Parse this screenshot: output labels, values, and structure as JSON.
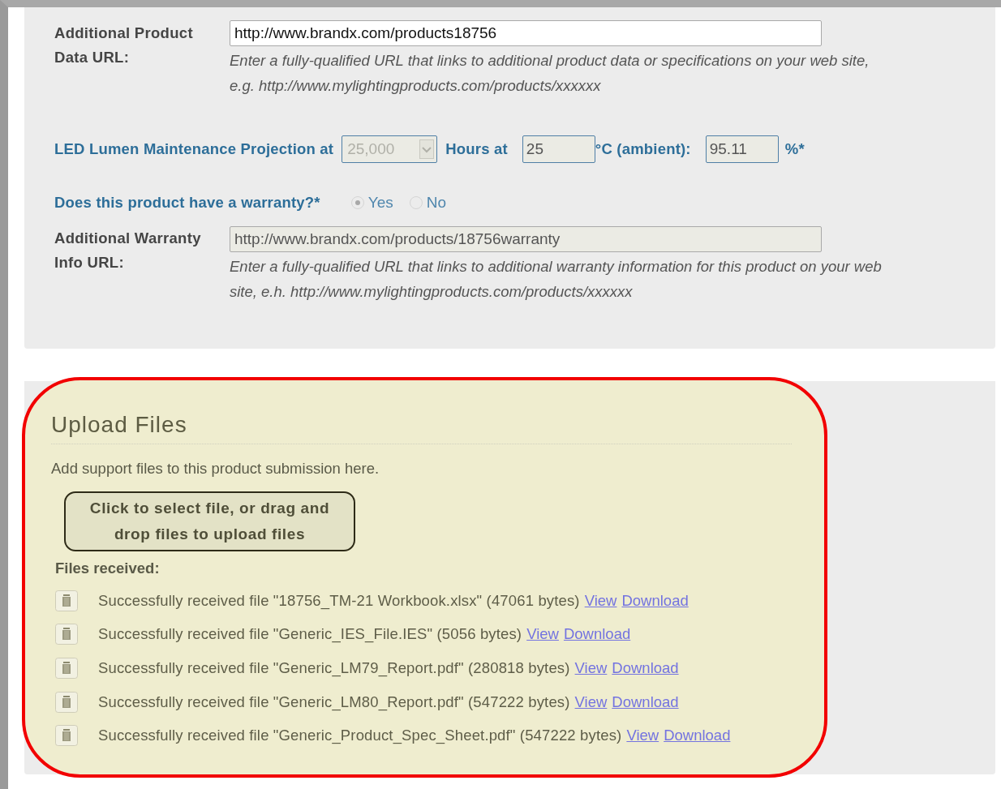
{
  "product_data_url": {
    "label": "Additional Product Data URL:",
    "value": "http://www.brandx.com/products18756",
    "disabled": false,
    "help_lines": [
      "Enter a fully-qualified URL that links to additional product data or specifications on your web site,",
      "e.g. http://www.mylightingproducts.com/products/xxxxxx"
    ]
  },
  "lumen_projection": {
    "label": "LED Lumen Maintenance Projection at",
    "hours": {
      "value": "25,000",
      "disabled": true
    },
    "hours_label": "Hours at",
    "temperature": {
      "value": "25",
      "disabled": true
    },
    "temperature_label": "°C (ambient):",
    "percent": {
      "value": "95.11",
      "disabled": true
    },
    "percent_label": "%*"
  },
  "warranty": {
    "question": "Does this product have a warranty?*",
    "options": [
      {
        "label": "Yes",
        "selected": true,
        "disabled": true
      },
      {
        "label": "No",
        "selected": false,
        "disabled": true
      }
    ]
  },
  "warranty_url": {
    "label": "Additional Warranty Info URL:",
    "value": "http://www.brandx.com/products/18756warranty",
    "disabled": true,
    "help_lines": [
      "Enter a fully-qualified URL that links to additional warranty information for this product on your web",
      "site, e.h. http://www.mylightingproducts.com/products/xxxxxx"
    ]
  },
  "upload": {
    "title": "Upload Files",
    "intro": "Add support files to this product submission here.",
    "button_lines": [
      "Click to select file, or drag and",
      "drop files to upload files"
    ],
    "files_heading": "Files received:",
    "files": [
      {
        "text": "Successfully received file \"18756_TM-21 Workbook.xlsx\" (47061 bytes)",
        "links": [
          "View",
          "Download"
        ]
      },
      {
        "text": "Successfully received file \"Generic_IES_File.IES\" (5056 bytes)",
        "links": [
          "View",
          "Download"
        ]
      },
      {
        "text": "Successfully received file \"Generic_LM79_Report.pdf\" (280818 bytes)",
        "links": [
          "View",
          "Download"
        ]
      },
      {
        "text": "Successfully received file \"Generic_LM80_Report.pdf\" (547222 bytes)",
        "links": [
          "View",
          "Download"
        ]
      },
      {
        "text": "Successfully received file \"Generic_Product_Spec_Sheet.pdf\" (547222 bytes)",
        "links": [
          "View",
          "Download"
        ]
      }
    ]
  }
}
